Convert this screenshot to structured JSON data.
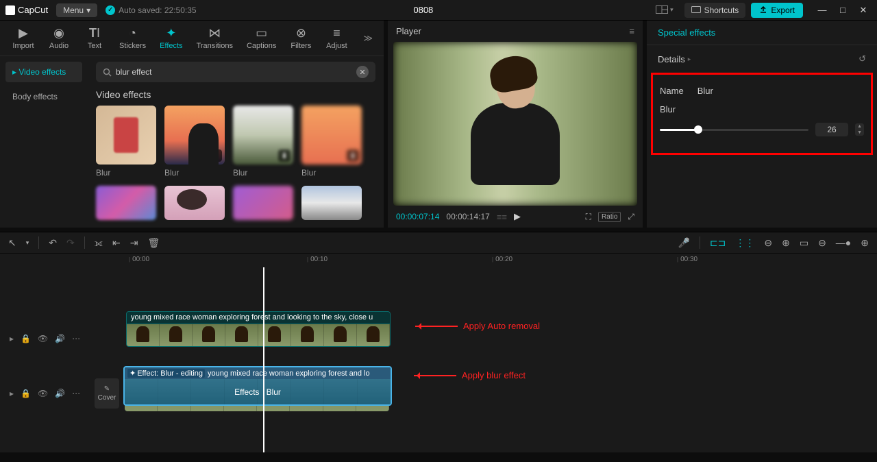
{
  "app": {
    "name": "CapCut",
    "menu": "Menu",
    "autosave": "Auto saved: 22:50:35",
    "title": "0808",
    "shortcuts": "Shortcuts",
    "export": "Export"
  },
  "toolTabs": {
    "import": "Import",
    "audio": "Audio",
    "text": "Text",
    "stickers": "Stickers",
    "effects": "Effects",
    "transitions": "Transitions",
    "captions": "Captions",
    "filters": "Filters",
    "adjust": "Adjust"
  },
  "effectsSidebar": {
    "videoEffects": "Video effects",
    "bodyEffects": "Body effects"
  },
  "search": {
    "value": "blur effect",
    "placeholder": ""
  },
  "effectsSection": {
    "title": "Video effects"
  },
  "effects": [
    {
      "label": "Blur"
    },
    {
      "label": "Blur"
    },
    {
      "label": "Blur"
    },
    {
      "label": "Blur"
    },
    {
      "label": ""
    },
    {
      "label": ""
    },
    {
      "label": ""
    },
    {
      "label": ""
    }
  ],
  "player": {
    "title": "Player",
    "current": "00:00:07:14",
    "total": "00:00:14:17",
    "ratio": "Ratio"
  },
  "rightPanel": {
    "tab": "Special effects",
    "details": "Details",
    "nameLabel": "Name",
    "nameValue": "Blur",
    "blurLabel": "Blur",
    "blurValue": "26"
  },
  "ruler": {
    "t0": "00:00",
    "t10": "00:10",
    "t20": "00:20",
    "t30": "00:30"
  },
  "clips": {
    "top": "young mixed race woman exploring forest and looking to the sky, close u",
    "fxTag": "Effect: Blur - editing",
    "bottomTitle": "young mixed race woman exploring forest and lo",
    "effectsWord": "Effects",
    "blurWord": "Blur"
  },
  "cover": "Cover",
  "annotations": {
    "auto": "Apply Auto removal",
    "blur": "Apply blur effect"
  }
}
